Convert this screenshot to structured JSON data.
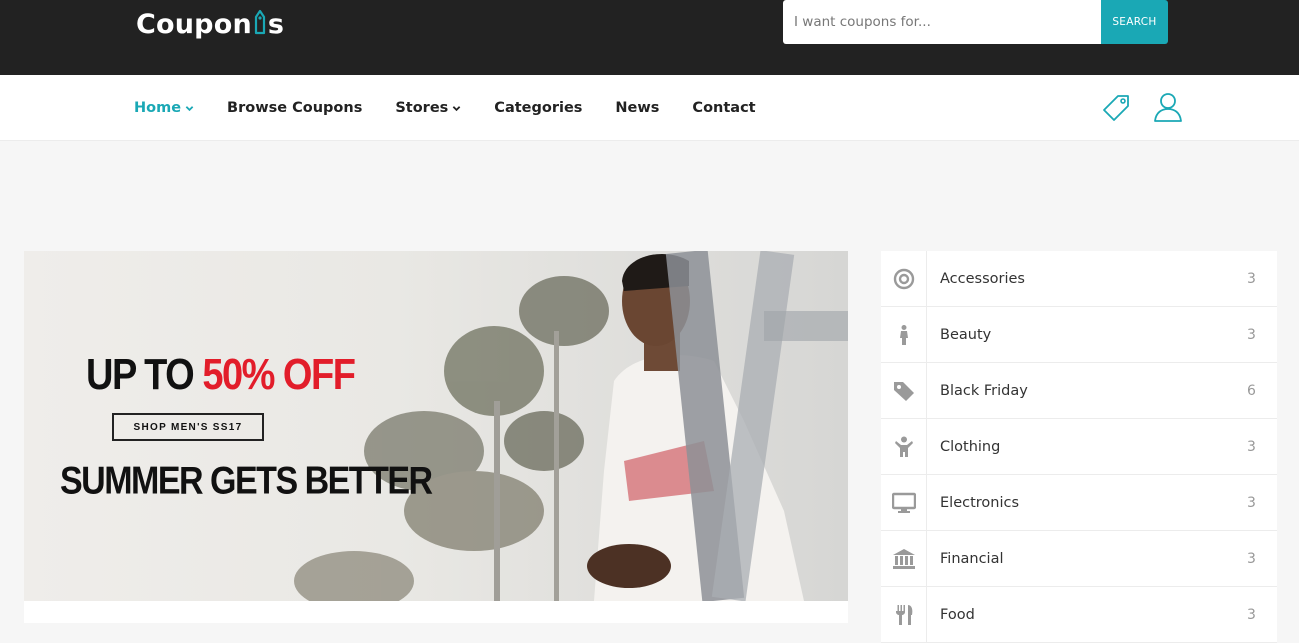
{
  "header": {
    "logo_text_before": "Coupon",
    "logo_text_after": "s",
    "search": {
      "placeholder": "I want coupons for...",
      "button_label": "SEARCH"
    }
  },
  "nav": {
    "items": [
      {
        "label": "Home",
        "active": true,
        "has_dropdown": true
      },
      {
        "label": "Browse Coupons",
        "active": false,
        "has_dropdown": false
      },
      {
        "label": "Stores",
        "active": false,
        "has_dropdown": true
      },
      {
        "label": "Categories",
        "active": false,
        "has_dropdown": false
      },
      {
        "label": "News",
        "active": false,
        "has_dropdown": false
      },
      {
        "label": "Contact",
        "active": false,
        "has_dropdown": false
      }
    ],
    "icons": [
      "tag-icon",
      "user-icon"
    ]
  },
  "banner": {
    "line1_prefix": "UP TO ",
    "line1_highlight": "50% OFF",
    "button_label": "SHOP MEN'S SS17",
    "line2": "SUMMER GETS BETTER"
  },
  "categories": [
    {
      "name": "Accessories",
      "count": "3",
      "icon": "target-icon"
    },
    {
      "name": "Beauty",
      "count": "3",
      "icon": "female-icon"
    },
    {
      "name": "Black Friday",
      "count": "6",
      "icon": "tag-icon"
    },
    {
      "name": "Clothing",
      "count": "3",
      "icon": "child-icon"
    },
    {
      "name": "Electronics",
      "count": "3",
      "icon": "monitor-icon"
    },
    {
      "name": "Financial",
      "count": "3",
      "icon": "bank-icon"
    },
    {
      "name": "Food",
      "count": "3",
      "icon": "cutlery-icon"
    }
  ],
  "colors": {
    "accent": "#1aa8b5",
    "topbar": "#222222",
    "sale_red": "#e21d2a"
  }
}
